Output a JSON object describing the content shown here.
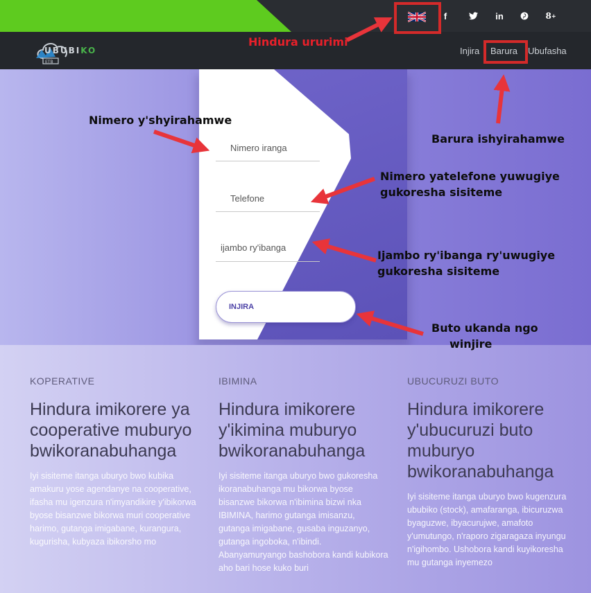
{
  "topbar": {
    "social": [
      "f",
      "✓",
      "in",
      "℗",
      "8⁺"
    ],
    "colors": {
      "green": "#5ecb1f",
      "dark": "#2a2d32"
    },
    "flag": "uk-flag-icon"
  },
  "navbar": {
    "logo_text_a": "UBUBI",
    "logo_text_b": "KO",
    "links": [
      "Injira",
      "Barura",
      "Ubufasha"
    ]
  },
  "login_form": {
    "fields": [
      "Nimero iranga",
      "Telefone",
      "ijambo ry'ibanga"
    ],
    "submit_label": "INJIRA"
  },
  "annotations": {
    "language": "Hindura ururimi",
    "id_number": "Nimero y'shyirahamwe",
    "email": "Barura ishyirahamwe",
    "phone_line1": "Nimero yatelefone yuwugiye",
    "phone_line2": "gukoresha sisiteme",
    "password_line1": "Ijambo ry'ibanga ry'uwugiye",
    "password_line2": "gukoresha sisiteme",
    "button_line1": "Buto ukanda ngo",
    "button_line2": "winjire",
    "arrow_color": "#e8343a"
  },
  "features": [
    {
      "category": "KOPERATIVE",
      "title": "Hindura imikorere ya cooperative muburyo bwikoranabuhanga",
      "description": "Iyi sisiteme itanga uburyo bwo kubika amakuru yose agendanye na cooperative, ifasha mu igenzura n'imyandikire y'ibikorwa byose bisanzwe bikorwa muri cooperative harimo, gutanga imigabane, kurangura, kugurisha, kubyaza ibikorsho mo"
    },
    {
      "category": "IBIMINA",
      "title": "Hindura imikorere y'ikimina muburyo bwikoranabuhanga",
      "description": "Iyi sisiteme itanga uburyo bwo gukoresha ikoranabuhanga mu bikorwa byose bisanzwe bikorwa n'ibimina bizwi nka IBIMINA, harimo gutanga imisanzu, gutanga imigabane, gusaba inguzanyo, gutanga ingoboka, n'ibindi. Abanyamuryango bashobora kandi kubikora aho bari hose kuko buri"
    },
    {
      "category": "UBUCURUZI BUTO",
      "title": "Hindura imikorere y'ubucuruzi buto muburyo bwikoranabuhanga",
      "description": "Iyi sisiteme itanga uburyo bwo kugenzura ububiko (stock), amafaranga, ibicuruzwa byaguzwe, ibyacurujwe, amafoto y'umutungo, n'raporo zigaragaza inyungu n'igihombo. Ushobora kandi kuyikoresha mu gutanga inyemezo"
    }
  ]
}
